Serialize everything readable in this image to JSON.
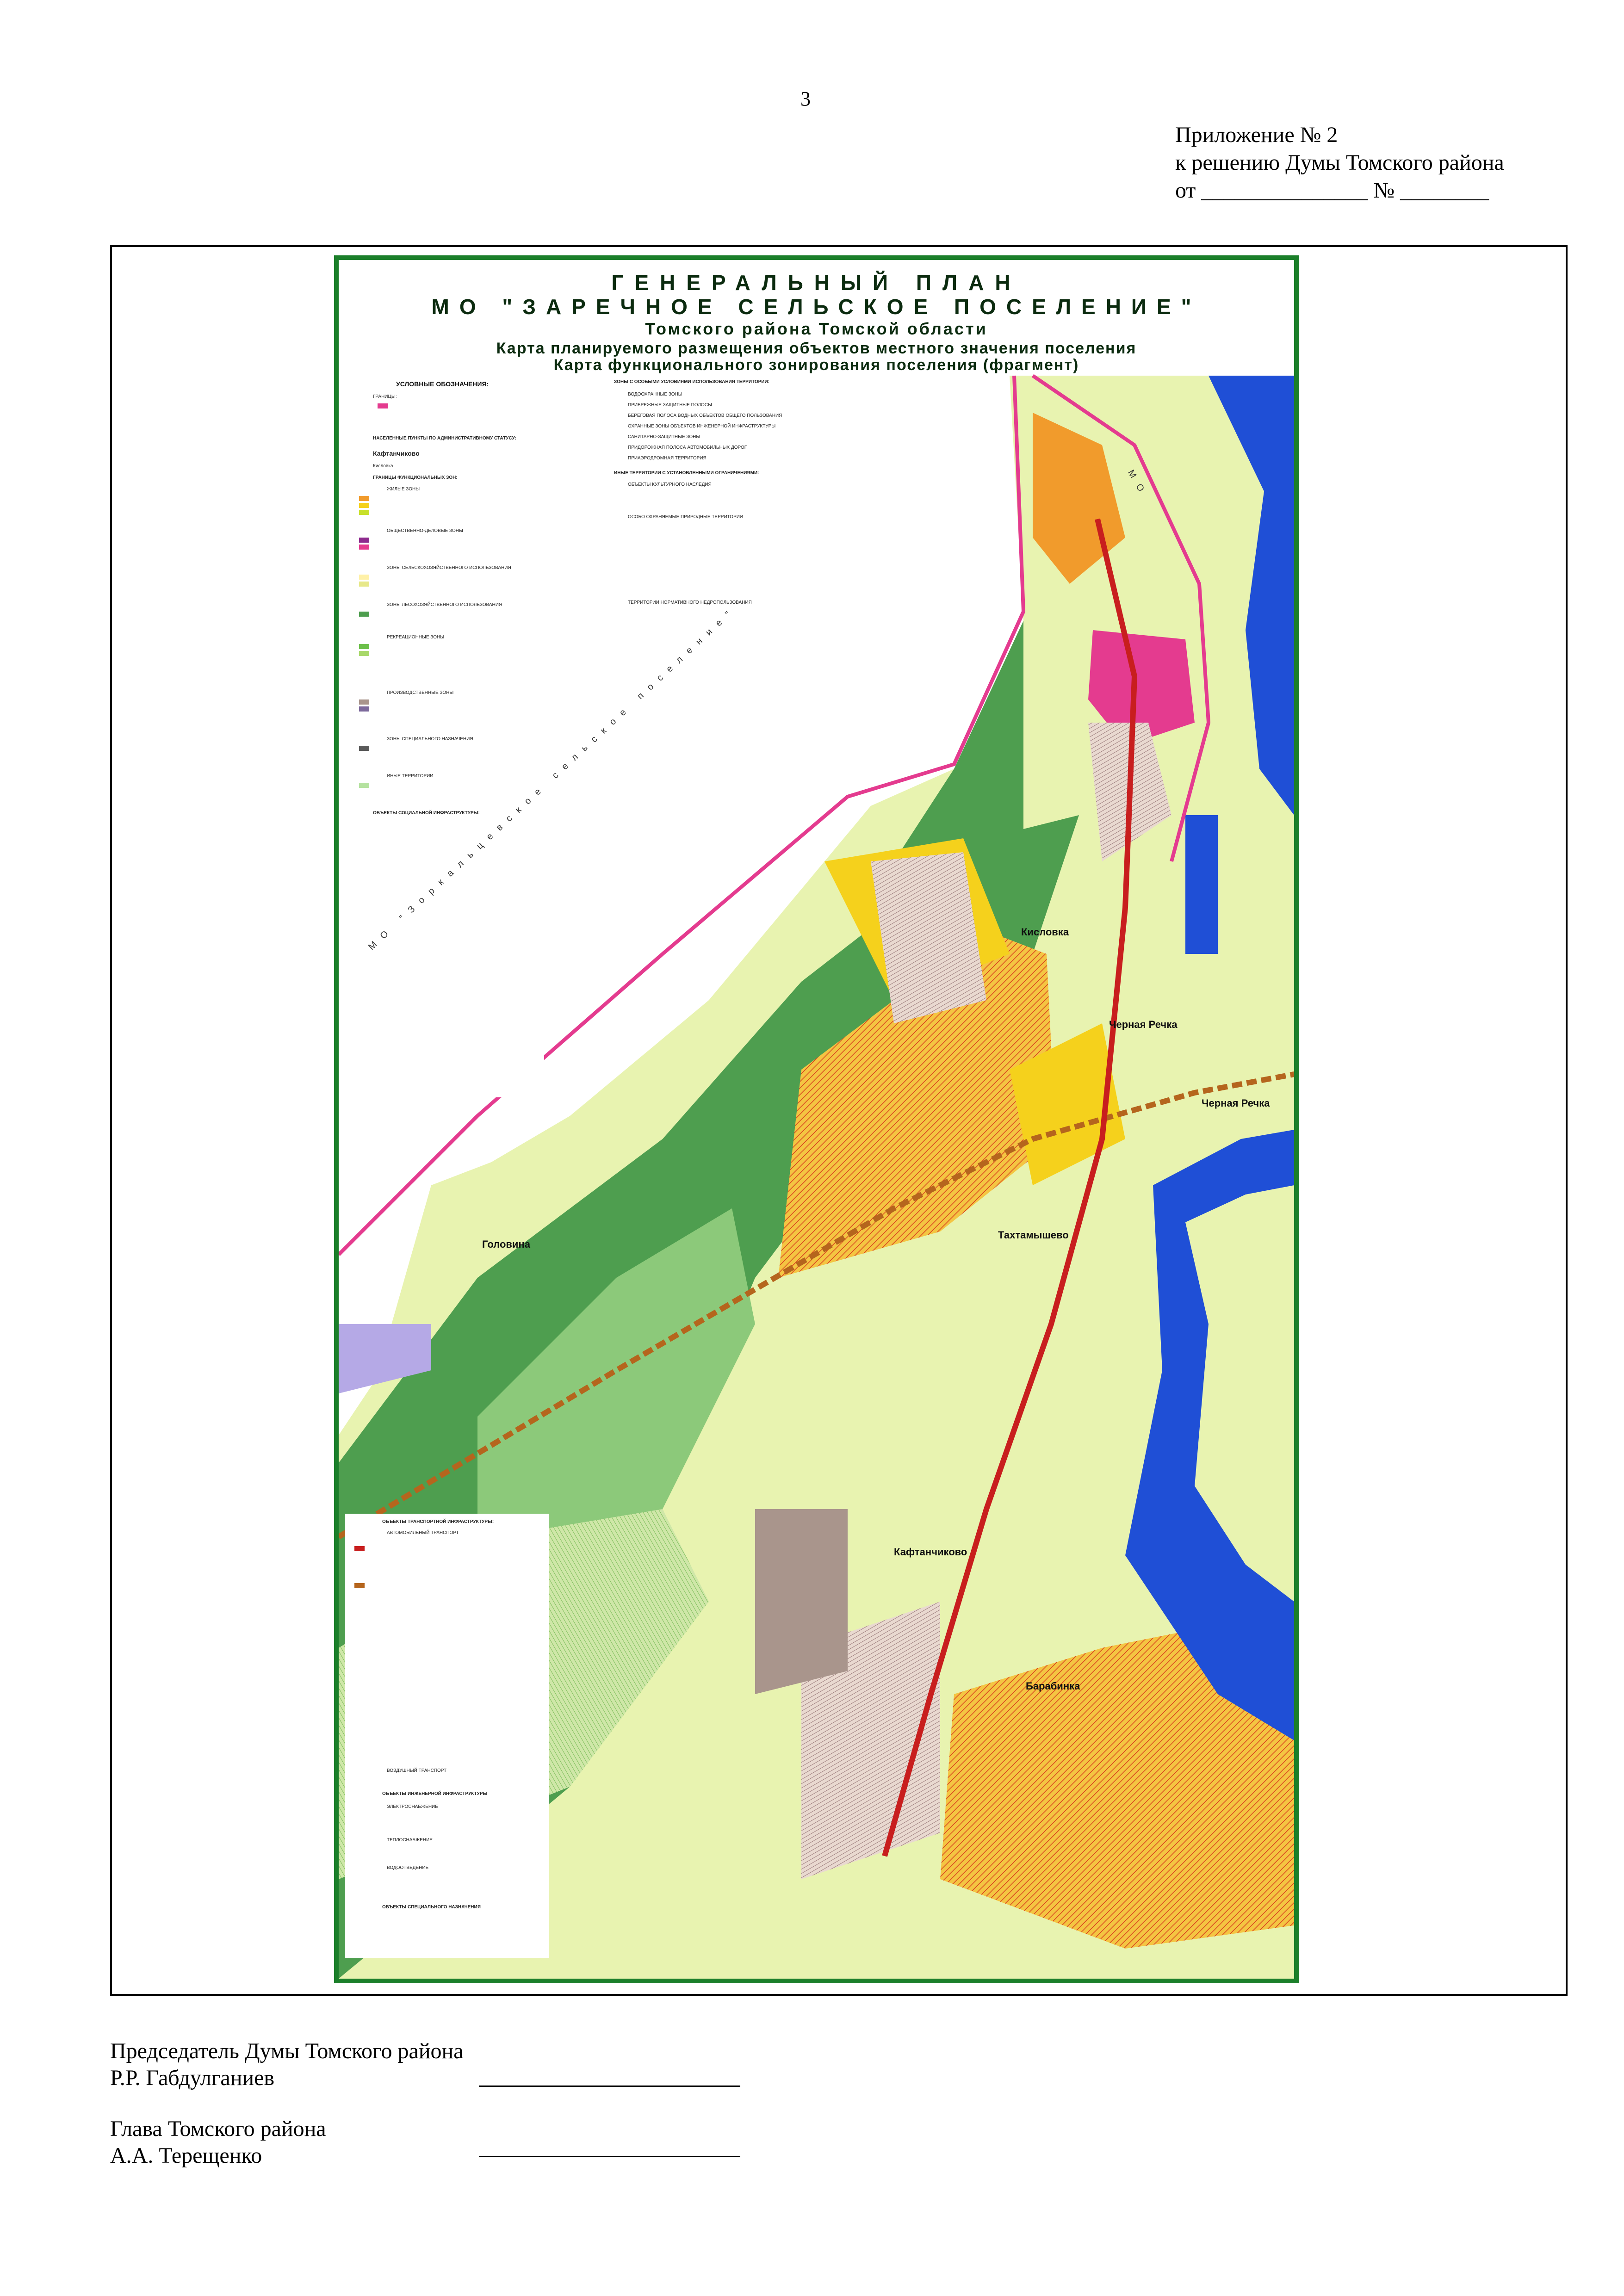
{
  "page_number": "3",
  "appendix": {
    "line1": "Приложение № 2",
    "line2": "к решению Думы Томского района",
    "line3": "от _______________ № ________"
  },
  "map": {
    "title_line1": "ГЕНЕРАЛЬНЫЙ ПЛАН",
    "title_line2": "МО \"ЗАРЕЧНОЕ СЕЛЬСКОЕ ПОСЕЛЕНИЕ\"",
    "title_line3": "Томского района Томской области",
    "title_line4": "Карта планируемого размещения объектов местного значения поселения",
    "title_line5": "Карта функционального зонирования поселения (фрагмент)",
    "legend_left_heading": "УСЛОВНЫЕ ОБОЗНАЧЕНИЯ:",
    "legend_left_items": [
      "ГРАНИЦЫ:",
      "НАСЕЛЕННЫЕ ПУНКТЫ ПО АДМИНИСТРАТИВНОМУ СТАТУСУ:",
      "Кафтанчиково",
      "Кисловка",
      "ГРАНИЦЫ ФУНКЦИОНАЛЬНЫХ ЗОН:",
      "ЖИЛЫЕ ЗОНЫ",
      "ОБЩЕСТВЕННО-ДЕЛОВЫЕ ЗОНЫ",
      "ЗОНЫ СЕЛЬСКОХОЗЯЙСТВЕННОГО ИСПОЛЬЗОВАНИЯ",
      "ЗОНЫ ЛЕСОХОЗЯЙСТВЕННОГО ИСПОЛЬЗОВАНИЯ",
      "РЕКРЕАЦИОННЫЕ ЗОНЫ",
      "ПРОИЗВОДСТВЕННЫЕ ЗОНЫ",
      "ЗОНЫ СПЕЦИАЛЬНОГО НАЗНАЧЕНИЯ",
      "ИНЫЕ ТЕРРИТОРИИ",
      "ОБЪЕКТЫ СОЦИАЛЬНОЙ ИНФРАСТРУКТУРЫ:"
    ],
    "legend_mid_heading": "ЗОНЫ С ОСОБЫМИ УСЛОВИЯМИ ИСПОЛЬЗОВАНИЯ ТЕРРИТОРИИ:",
    "legend_mid_items": [
      "ВОДООХРАННЫЕ ЗОНЫ",
      "ПРИБРЕЖНЫЕ ЗАЩИТНЫЕ ПОЛОСЫ",
      "БЕРЕГОВАЯ ПОЛОСА ВОДНЫХ ОБЪЕКТОВ ОБЩЕГО ПОЛЬЗОВАНИЯ",
      "ОХРАННЫЕ ЗОНЫ ОБЪЕКТОВ ИНЖЕНЕРНОЙ ИНФРАСТРУКТУРЫ",
      "САНИТАРНО-ЗАЩИТНЫЕ ЗОНЫ",
      "ПРИДОРОЖНАЯ ПОЛОСА АВТОМОБИЛЬНЫХ ДОРОГ",
      "ПРИАЭРОДРОМНАЯ ТЕРРИТОРИЯ",
      "ИНЫЕ ТЕРРИТОРИИ С УСТАНОВЛЕННЫМИ ОГРАНИЧЕНИЯМИ:",
      "ОБЪЕКТЫ КУЛЬТУРНОГО НАСЛЕДИЯ",
      "ОСОБО ОХРАНЯЕМЫЕ ПРИРОДНЫЕ ТЕРРИТОРИИ",
      "ТЕРРИТОРИИ НОРМАТИВНОГО НЕДРОПОЛЬЗОВАНИЯ"
    ],
    "legend_bottom_heading": "ОБЪЕКТЫ ТРАНСПОРТНОЙ ИНФРАСТРУКТУРЫ:",
    "legend_bottom_items": [
      "АВТОМОБИЛЬНЫЙ ТРАНСПОРТ",
      "ВОЗДУШНЫЙ ТРАНСПОРТ",
      "ОБЪЕКТЫ ИНЖЕНЕРНОЙ ИНФРАСТРУКТУРЫ",
      "ЭЛЕКТРОСНАБЖЕНИЕ",
      "ТЕПЛОСНАБЖЕНИЕ",
      "ВОДООТВЕДЕНИЕ",
      "ОБЪЕКТЫ СПЕЦИАЛЬНОГО НАЗНАЧЕНИЯ"
    ],
    "places": [
      "Кисловка",
      "Черная Речка",
      "Черная Речка",
      "Тахтамышево",
      "Головина",
      "Кафтанчиково",
      "Барабинка"
    ],
    "boundary_label_1": "МО \"Зоркальцевское сельское поселение\"",
    "boundary_label_2": "МО"
  },
  "signatures": [
    {
      "title": "Председатель Думы Томского района",
      "name": "Р.Р. Габдулганиев"
    },
    {
      "title": "Глава Томского района",
      "name": "А.А. Терещенко"
    }
  ],
  "colors": {
    "forest": "#5aa855",
    "river": "#1f4fd6",
    "residential": "#f5d11c",
    "road": "#c81e1e",
    "border": "#1b7f2a"
  }
}
